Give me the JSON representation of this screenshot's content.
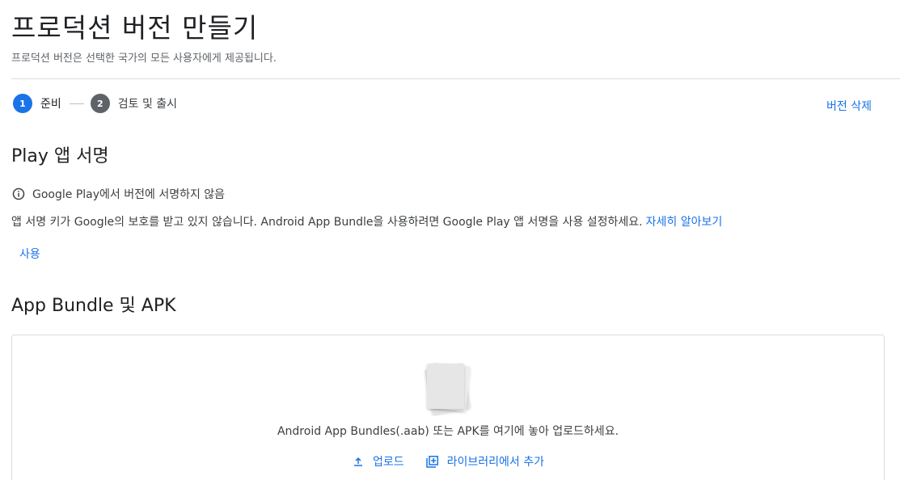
{
  "header": {
    "title": "프로덕션 버전 만들기",
    "subtitle": "프로덕션 버전은 선택한 국가의 모든 사용자에게 제공됩니다."
  },
  "stepper": {
    "steps": [
      {
        "number": "1",
        "label": "준비",
        "state": "active"
      },
      {
        "number": "2",
        "label": "검토 및 출시",
        "state": "inactive"
      }
    ]
  },
  "actions": {
    "delete_version": "버전 삭제"
  },
  "app_signing": {
    "heading": "Play 앱 서명",
    "status_icon": "info-icon",
    "status_text": "Google Play에서 버전에 서명하지 않음",
    "description": "앱 서명 키가 Google의 보호를 받고 있지 않습니다. Android App Bundle을 사용하려면 Google Play 앱 서명을 사용 설정하세요.",
    "learn_more": "자세히 알아보기",
    "enable_button": "사용"
  },
  "bundles": {
    "heading": "App Bundle 및 APK",
    "drop_text": "Android App Bundles(.aab) 또는 APK를 여기에 놓아 업로드하세요.",
    "upload_label": "업로드",
    "upload_icon": "upload-icon",
    "library_label": "라이브러리에서 추가",
    "library_icon": "library-add-icon"
  },
  "colors": {
    "accent": "#1a73e8",
    "text_primary": "#202124",
    "text_secondary": "#5f6368",
    "divider": "#dadce0"
  }
}
